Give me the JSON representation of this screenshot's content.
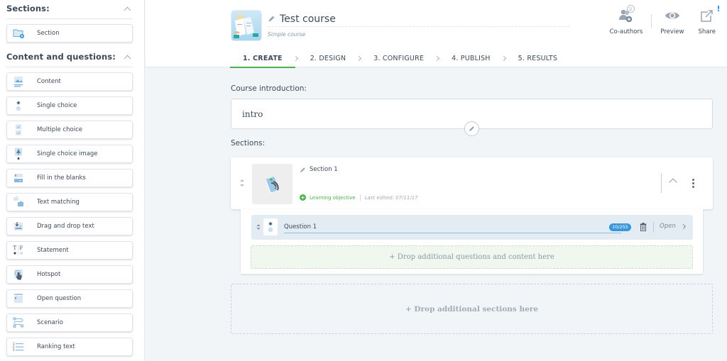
{
  "sidebar": {
    "sections_group": {
      "title": "Sections:",
      "items": [
        {
          "label": "Section",
          "icon": "folder-add-icon"
        }
      ]
    },
    "content_group": {
      "title": "Content and questions:",
      "items": [
        {
          "label": "Content",
          "icon": "image-content-icon"
        },
        {
          "label": "Single choice",
          "icon": "radio-icon"
        },
        {
          "label": "Multiple choice",
          "icon": "checkbox-icon"
        },
        {
          "label": "Single choice image",
          "icon": "tree-image-icon"
        },
        {
          "label": "Fill in the blanks",
          "icon": "fill-blanks-icon"
        },
        {
          "label": "Text matching",
          "icon": "puzzle-icon"
        },
        {
          "label": "Drag and drop text",
          "icon": "drag-drop-icon"
        },
        {
          "label": "Statement",
          "icon": "true-false-icon"
        },
        {
          "label": "Hotspot",
          "icon": "hand-pointer-icon"
        },
        {
          "label": "Open question",
          "icon": "open-question-icon"
        },
        {
          "label": "Scenario",
          "icon": "branching-icon"
        },
        {
          "label": "Ranking text",
          "icon": "ordered-list-icon"
        }
      ]
    }
  },
  "header": {
    "course_title": "Test course",
    "course_type": "Simple course",
    "actions": [
      {
        "label": "Co-authors",
        "icon": "co-authors-icon",
        "count": "2"
      },
      {
        "label": "Preview",
        "icon": "eye-icon"
      },
      {
        "label": "Share",
        "icon": "share-icon",
        "alert": "!"
      }
    ],
    "steps": [
      {
        "label": "1. CREATE",
        "active": true
      },
      {
        "label": "2. DESIGN"
      },
      {
        "label": "3. CONFIGURE"
      },
      {
        "label": "4. PUBLISH"
      },
      {
        "label": "5. RESULTS"
      }
    ]
  },
  "main": {
    "intro_label": "Course introduction:",
    "intro_text": "intro",
    "sections_label": "Sections:",
    "section": {
      "title": "Section 1",
      "learning_objective": "Learning objective",
      "last_edited": "Last edited: 07/11/17",
      "question": {
        "title": "Question 1",
        "counter": "10/255",
        "open_label": "Open"
      },
      "drop_questions": "+ Drop additional questions and content here"
    },
    "drop_sections": "+ Drop additional sections here"
  },
  "colors": {
    "accent_green": "#4bb24c",
    "accent_blue": "#3b96d9",
    "background": "#f2f5f8"
  }
}
